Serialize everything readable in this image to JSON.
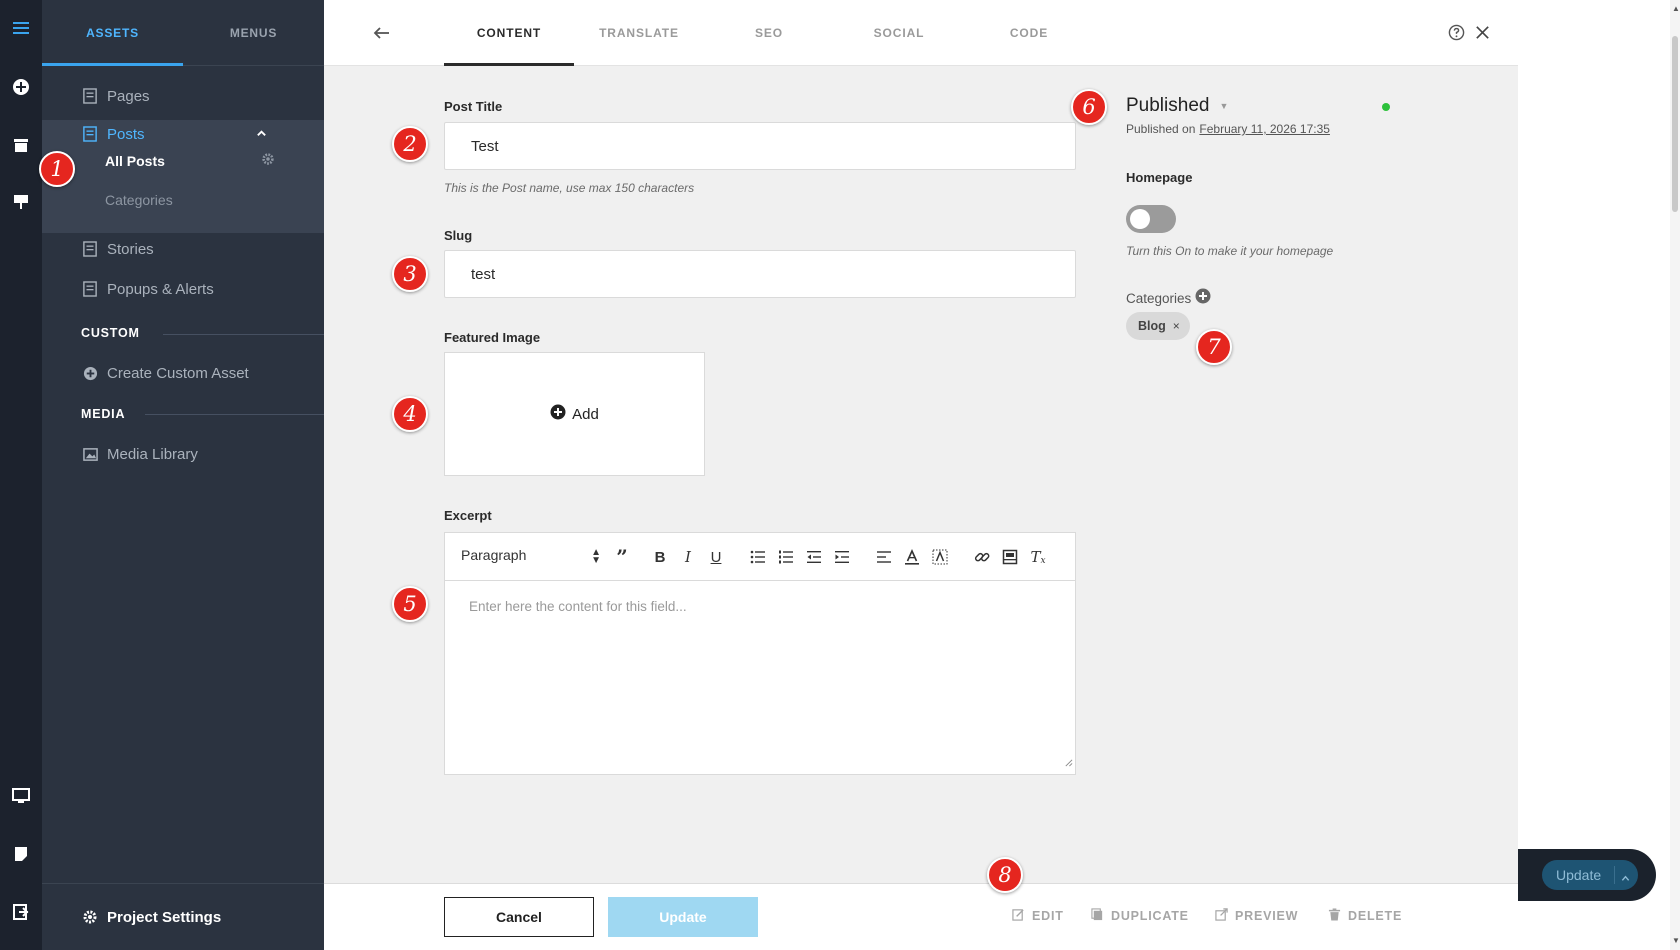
{
  "sidebar": {
    "tabs": [
      "ASSETS",
      "MENUS"
    ],
    "items": {
      "pages": "Pages",
      "posts": "Posts",
      "all_posts": "All Posts",
      "categories": "Categories",
      "stories": "Stories",
      "popups": "Popups & Alerts",
      "create_custom": "Create Custom Asset",
      "media_library": "Media Library"
    },
    "sections": {
      "custom": "CUSTOM",
      "media": "MEDIA"
    },
    "project_settings": "Project Settings"
  },
  "topbar": {
    "tabs": [
      "CONTENT",
      "TRANSLATE",
      "SEO",
      "SOCIAL",
      "CODE"
    ],
    "active_tab": "CONTENT"
  },
  "form": {
    "post_title": {
      "label": "Post Title",
      "value": "Test",
      "hint": "This is the Post name, use max 150 characters"
    },
    "slug": {
      "label": "Slug",
      "value": "test"
    },
    "featured_image": {
      "label": "Featured Image",
      "add_label": "Add"
    },
    "excerpt": {
      "label": "Excerpt",
      "format_select": "Paragraph",
      "placeholder": "Enter here the content for this field..."
    }
  },
  "status": {
    "label": "Published",
    "published_on_prefix": "Published on",
    "published_date": "February 11, 2026 17:35",
    "indicator_color": "#2dc13b"
  },
  "homepage": {
    "label": "Homepage",
    "toggle_on": false,
    "hint": "Turn this On to make it your homepage"
  },
  "categories": {
    "label": "Categories",
    "tags": [
      "Blog"
    ]
  },
  "footer": {
    "cancel": "Cancel",
    "update": "Update",
    "actions": [
      "EDIT",
      "DUPLICATE",
      "PREVIEW",
      "DELETE"
    ]
  },
  "floating_update": "Update",
  "callouts": [
    "1",
    "2",
    "3",
    "4",
    "5",
    "6",
    "7",
    "8"
  ],
  "colors": {
    "accent": "#3aa4ee",
    "callout": "#e5261f",
    "sidebar_bg": "#2b3340",
    "rail_bg": "#1c222d",
    "update_disabled": "#9fd8f2"
  }
}
